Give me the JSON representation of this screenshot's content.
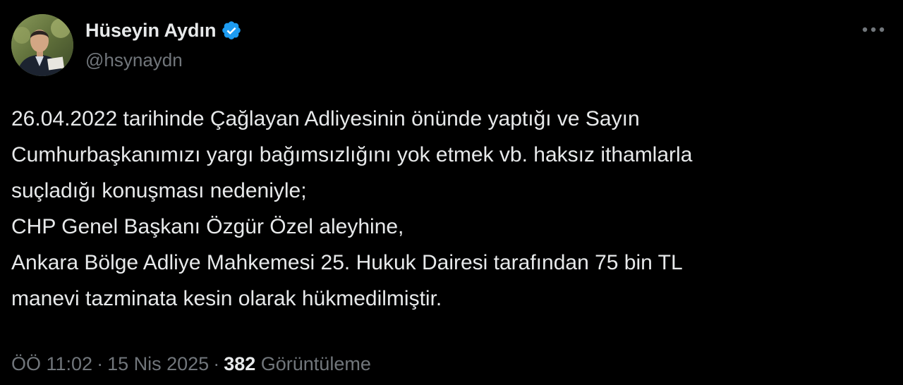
{
  "author": {
    "display_name": "Hüseyin Aydın",
    "handle": "@hsynaydn",
    "verified": true,
    "verified_color": "#1d9bf0"
  },
  "icons": {
    "verified": "verified-badge-icon",
    "more": "more-options-icon"
  },
  "tweet": {
    "lines": [
      "26.04.2022  tarihinde Çağlayan Adliyesinin önünde yaptığı ve Sayın",
      "Cumhurbaşkanımızı yargı bağımsızlığını yok etmek vb. haksız ithamlarla",
      "suçladığı konuşması nedeniyle;",
      "CHP Genel Başkanı Özgür Özel aleyhine,",
      "Ankara Bölge Adliye Mahkemesi 25. Hukuk Dairesi tarafından 75 bin TL",
      "manevi tazminata kesin olarak hükmedilmiştir."
    ]
  },
  "meta": {
    "time": "ÖÖ 11:02",
    "date": "15 Nis 2025",
    "views_count": "382",
    "views_label": "Görüntüleme",
    "separator": "·"
  },
  "colors": {
    "background": "#000000",
    "text_primary": "#e7e9ea",
    "text_secondary": "#71767b"
  }
}
